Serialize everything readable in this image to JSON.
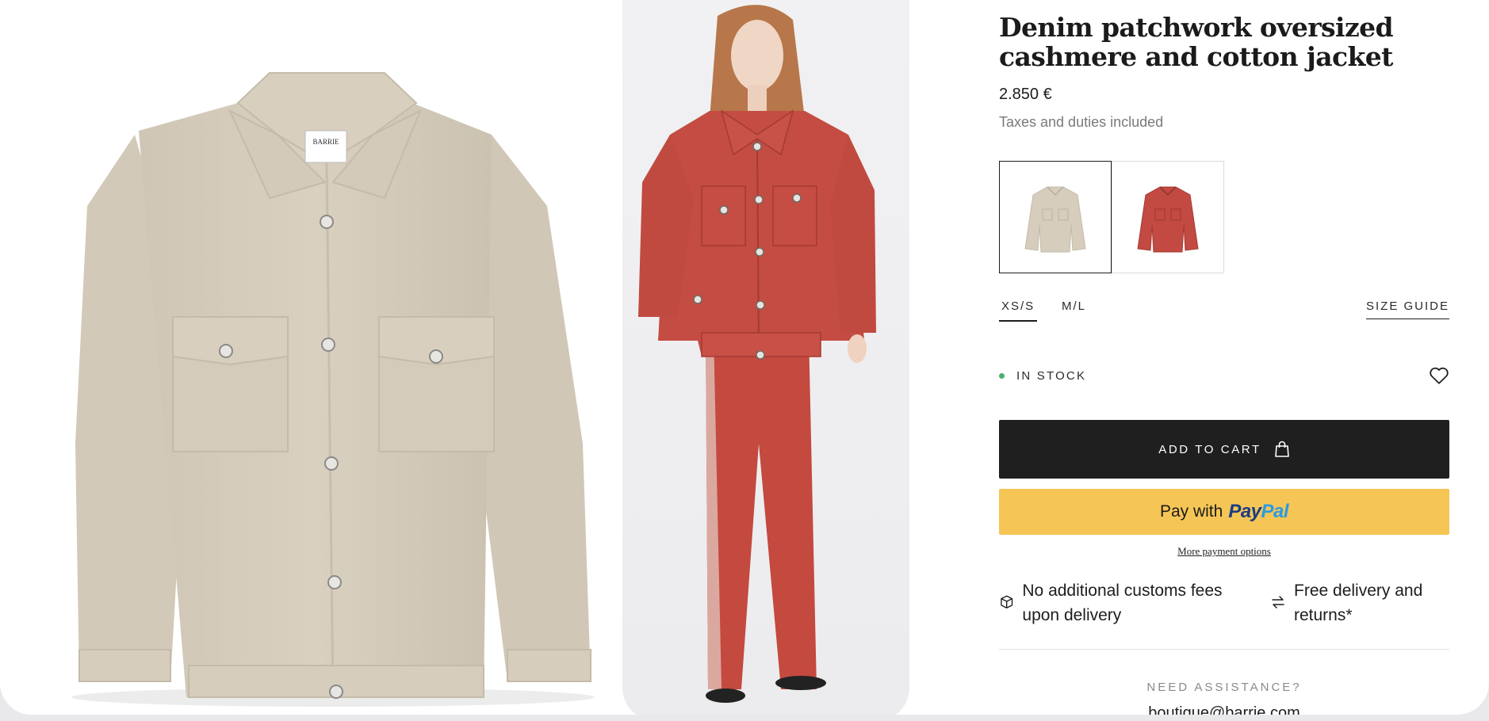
{
  "product": {
    "title": "Denim patchwork oversized cashmere and cotton jacket",
    "price": "2.850 €",
    "tax_note": "Taxes and duties included"
  },
  "images": {
    "main_alt": "beige knit jacket",
    "model_alt": "model wearing red jacket and trousers",
    "label_brand": "BARRIE"
  },
  "colors": {
    "beige": "#d6cdbd",
    "red": "#c24a42",
    "stock_dot": "#4caf72",
    "cart_bg": "#1f1f1f",
    "paypal_bg": "#f5c556"
  },
  "sizes": {
    "options": [
      "XS/S",
      "M/L"
    ],
    "selected": "XS/S",
    "guide_label": "SIZE GUIDE"
  },
  "availability": {
    "label": "IN STOCK"
  },
  "actions": {
    "add_to_cart": "ADD TO CART",
    "paypal_prefix": "Pay with",
    "paypal_brand_1": "Pay",
    "paypal_brand_2": "Pal",
    "more_payment": "More payment options"
  },
  "benefits": [
    {
      "icon": "box-icon",
      "text": "No additional customs fees upon delivery"
    },
    {
      "icon": "exchange-arrows-icon",
      "text": "Free delivery and returns*"
    }
  ],
  "assistance": {
    "heading": "NEED ASSISTANCE?",
    "email_partial": "boutique@barrie.com"
  }
}
